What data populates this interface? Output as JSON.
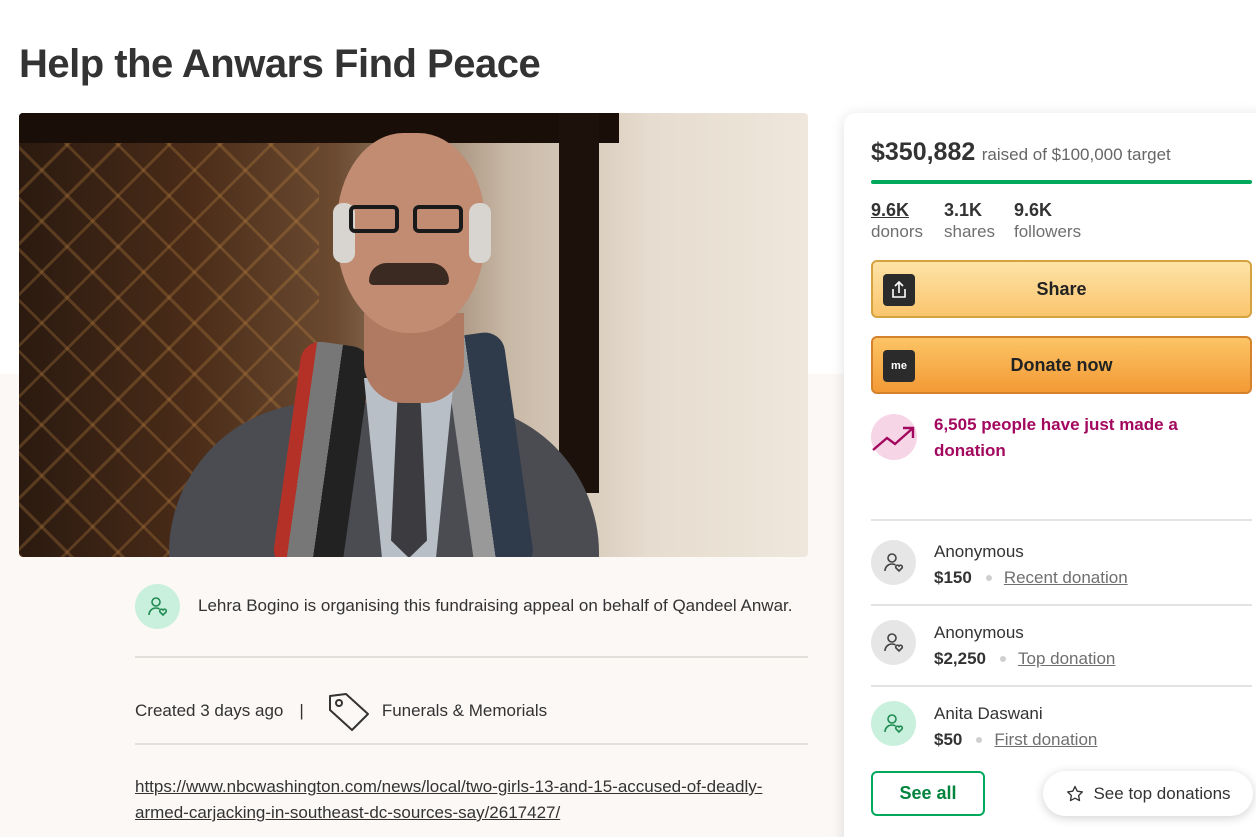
{
  "campaign": {
    "title": "Help the Anwars Find Peace",
    "organiser_text": "Lehra Bogino is organising this fundraising appeal on behalf of Qandeel Anwar.",
    "created": "Created 3 days ago",
    "separator": "|",
    "category": "Funerals & Memorials",
    "link": "https://www.nbcwashington.com/news/local/two-girls-13-and-15-accused-of-deadly-armed-carjacking-in-southeast-dc-sources-say/2617427/"
  },
  "donation_card": {
    "raised_amount": "$350,882",
    "raised_of": "raised of $100,000 target",
    "progress_percent": 100,
    "stats": [
      {
        "value": "9.6K",
        "label": "donors"
      },
      {
        "value": "3.1K",
        "label": "shares"
      },
      {
        "value": "9.6K",
        "label": "followers"
      }
    ],
    "share_label": "Share",
    "donate_label": "Donate now",
    "donate_icon_text": "me",
    "trend_text": "6,505 people have just made a donation",
    "donations": [
      {
        "name": "Anonymous",
        "amount": "$150",
        "kind": "Recent donation"
      },
      {
        "name": "Anonymous",
        "amount": "$2,250",
        "kind": "Top donation"
      },
      {
        "name": "Anita Daswani",
        "amount": "$50",
        "kind": "First donation"
      }
    ],
    "see_all_label": "See all",
    "see_top_label": "See top donations"
  },
  "colors": {
    "accent_green": "#02a95c",
    "trend_magenta": "#a3085f",
    "donate_orange": "#f39a35",
    "share_yellow": "#fbc56d"
  },
  "icons": [
    "share-icon",
    "gofundme-icon",
    "trending-up-icon",
    "user-heart-icon",
    "tag-icon",
    "star-icon"
  ]
}
